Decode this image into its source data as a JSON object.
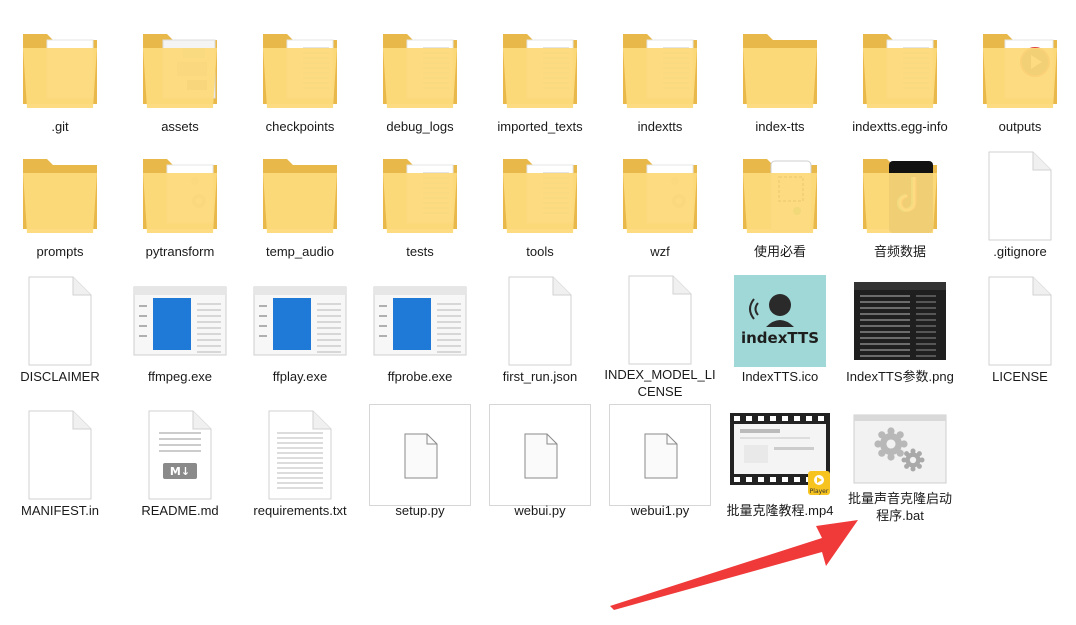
{
  "files": [
    {
      "name": ".git",
      "type": "folder",
      "preview": "blank"
    },
    {
      "name": "assets",
      "type": "folder",
      "preview": "image"
    },
    {
      "name": "checkpoints",
      "type": "folder",
      "preview": "docs"
    },
    {
      "name": "debug_logs",
      "type": "folder",
      "preview": "docs"
    },
    {
      "name": "imported_texts",
      "type": "folder",
      "preview": "docs"
    },
    {
      "name": "indextts",
      "type": "folder",
      "preview": "docs"
    },
    {
      "name": "index-tts",
      "type": "folder",
      "preview": "empty"
    },
    {
      "name": "indextts.egg-info",
      "type": "folder",
      "preview": "docs"
    },
    {
      "name": "outputs",
      "type": "folder",
      "preview": "media"
    },
    {
      "name": "prompts",
      "type": "folder",
      "preview": "empty"
    },
    {
      "name": "pytransform",
      "type": "folder",
      "preview": "gear"
    },
    {
      "name": "temp_audio",
      "type": "folder",
      "preview": "empty"
    },
    {
      "name": "tests",
      "type": "folder",
      "preview": "docs"
    },
    {
      "name": "tools",
      "type": "folder",
      "preview": "docs"
    },
    {
      "name": "wzf",
      "type": "folder",
      "preview": "gear"
    },
    {
      "name": "使用必看",
      "type": "folder",
      "preview": "qr"
    },
    {
      "name": "音频数据",
      "type": "folder",
      "preview": "tiktok"
    },
    {
      "name": ".gitignore",
      "type": "file"
    },
    {
      "name": "DISCLAIMER",
      "type": "file"
    },
    {
      "name": "ffmpeg.exe",
      "type": "exe"
    },
    {
      "name": "ffplay.exe",
      "type": "exe"
    },
    {
      "name": "ffprobe.exe",
      "type": "exe"
    },
    {
      "name": "first_run.json",
      "type": "file"
    },
    {
      "name": "INDEX_MODEL_LICENSE",
      "type": "file"
    },
    {
      "name": "IndexTTS.ico",
      "type": "ico",
      "ico_text": "indexTTS"
    },
    {
      "name": "IndexTTS参数.png",
      "type": "png"
    },
    {
      "name": "LICENSE",
      "type": "file"
    },
    {
      "name": "MANIFEST.in",
      "type": "file"
    },
    {
      "name": "README.md",
      "type": "md",
      "md_badge": "M↓"
    },
    {
      "name": "requirements.txt",
      "type": "txt"
    },
    {
      "name": "setup.py",
      "type": "py"
    },
    {
      "name": "webui.py",
      "type": "py"
    },
    {
      "name": "webui1.py",
      "type": "py"
    },
    {
      "name": "批量克隆教程.mp4",
      "type": "mp4",
      "player_badge": "Player"
    },
    {
      "name": "批量声音克隆启动程序.bat",
      "type": "bat"
    }
  ],
  "colors": {
    "folder_back": "#e8b84a",
    "folder_front": "#fcd97a",
    "arrow": "#f03a3a",
    "exe_blue": "#1e7ad6",
    "ico_bg": "#9fd8d6"
  }
}
